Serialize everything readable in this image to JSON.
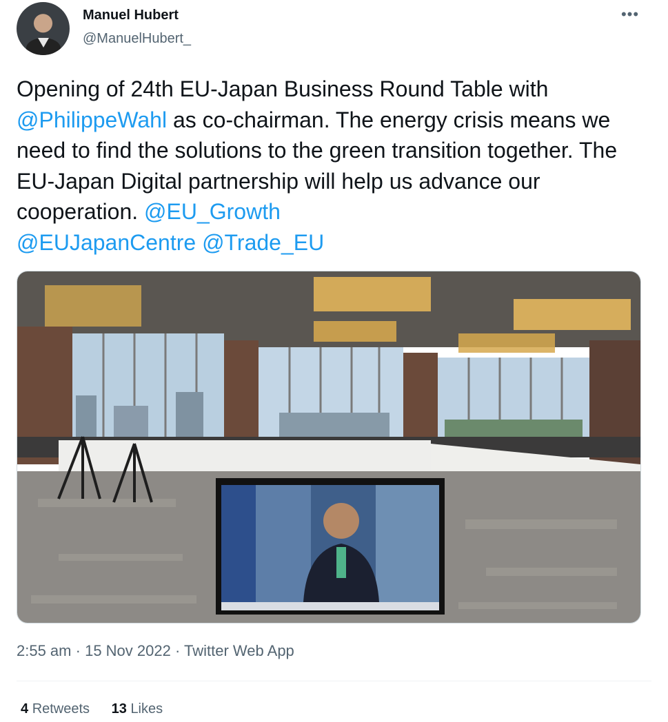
{
  "author": {
    "name": "Manuel Hubert",
    "handle": "@ManuelHubert_"
  },
  "tweet": {
    "text_1": "Opening of 24th EU-Japan Business Round Table with",
    "mention_1": "@PhilippeWahl",
    "text_2": "  as co-chairman. The energy crisis means we need to find the solutions to the green transition together. The EU-Japan Digital partnership will help us advance our cooperation.",
    "mention_2": "@EU_Growth",
    "mention_3": "@EUJapanCentre",
    "mention_4": "@Trade_EU"
  },
  "meta": {
    "time": "2:55 am",
    "separator": "·",
    "date": "15 Nov 2022",
    "app": "Twitter Web App"
  },
  "stats": {
    "retweets_count": "4",
    "retweets_label": "Retweets",
    "likes_count": "13",
    "likes_label": "Likes"
  },
  "icons": {
    "more": "more-options-icon"
  },
  "colors": {
    "link": "#1d9bf0",
    "secondary_text": "#536471",
    "primary_text": "#0f1419"
  }
}
